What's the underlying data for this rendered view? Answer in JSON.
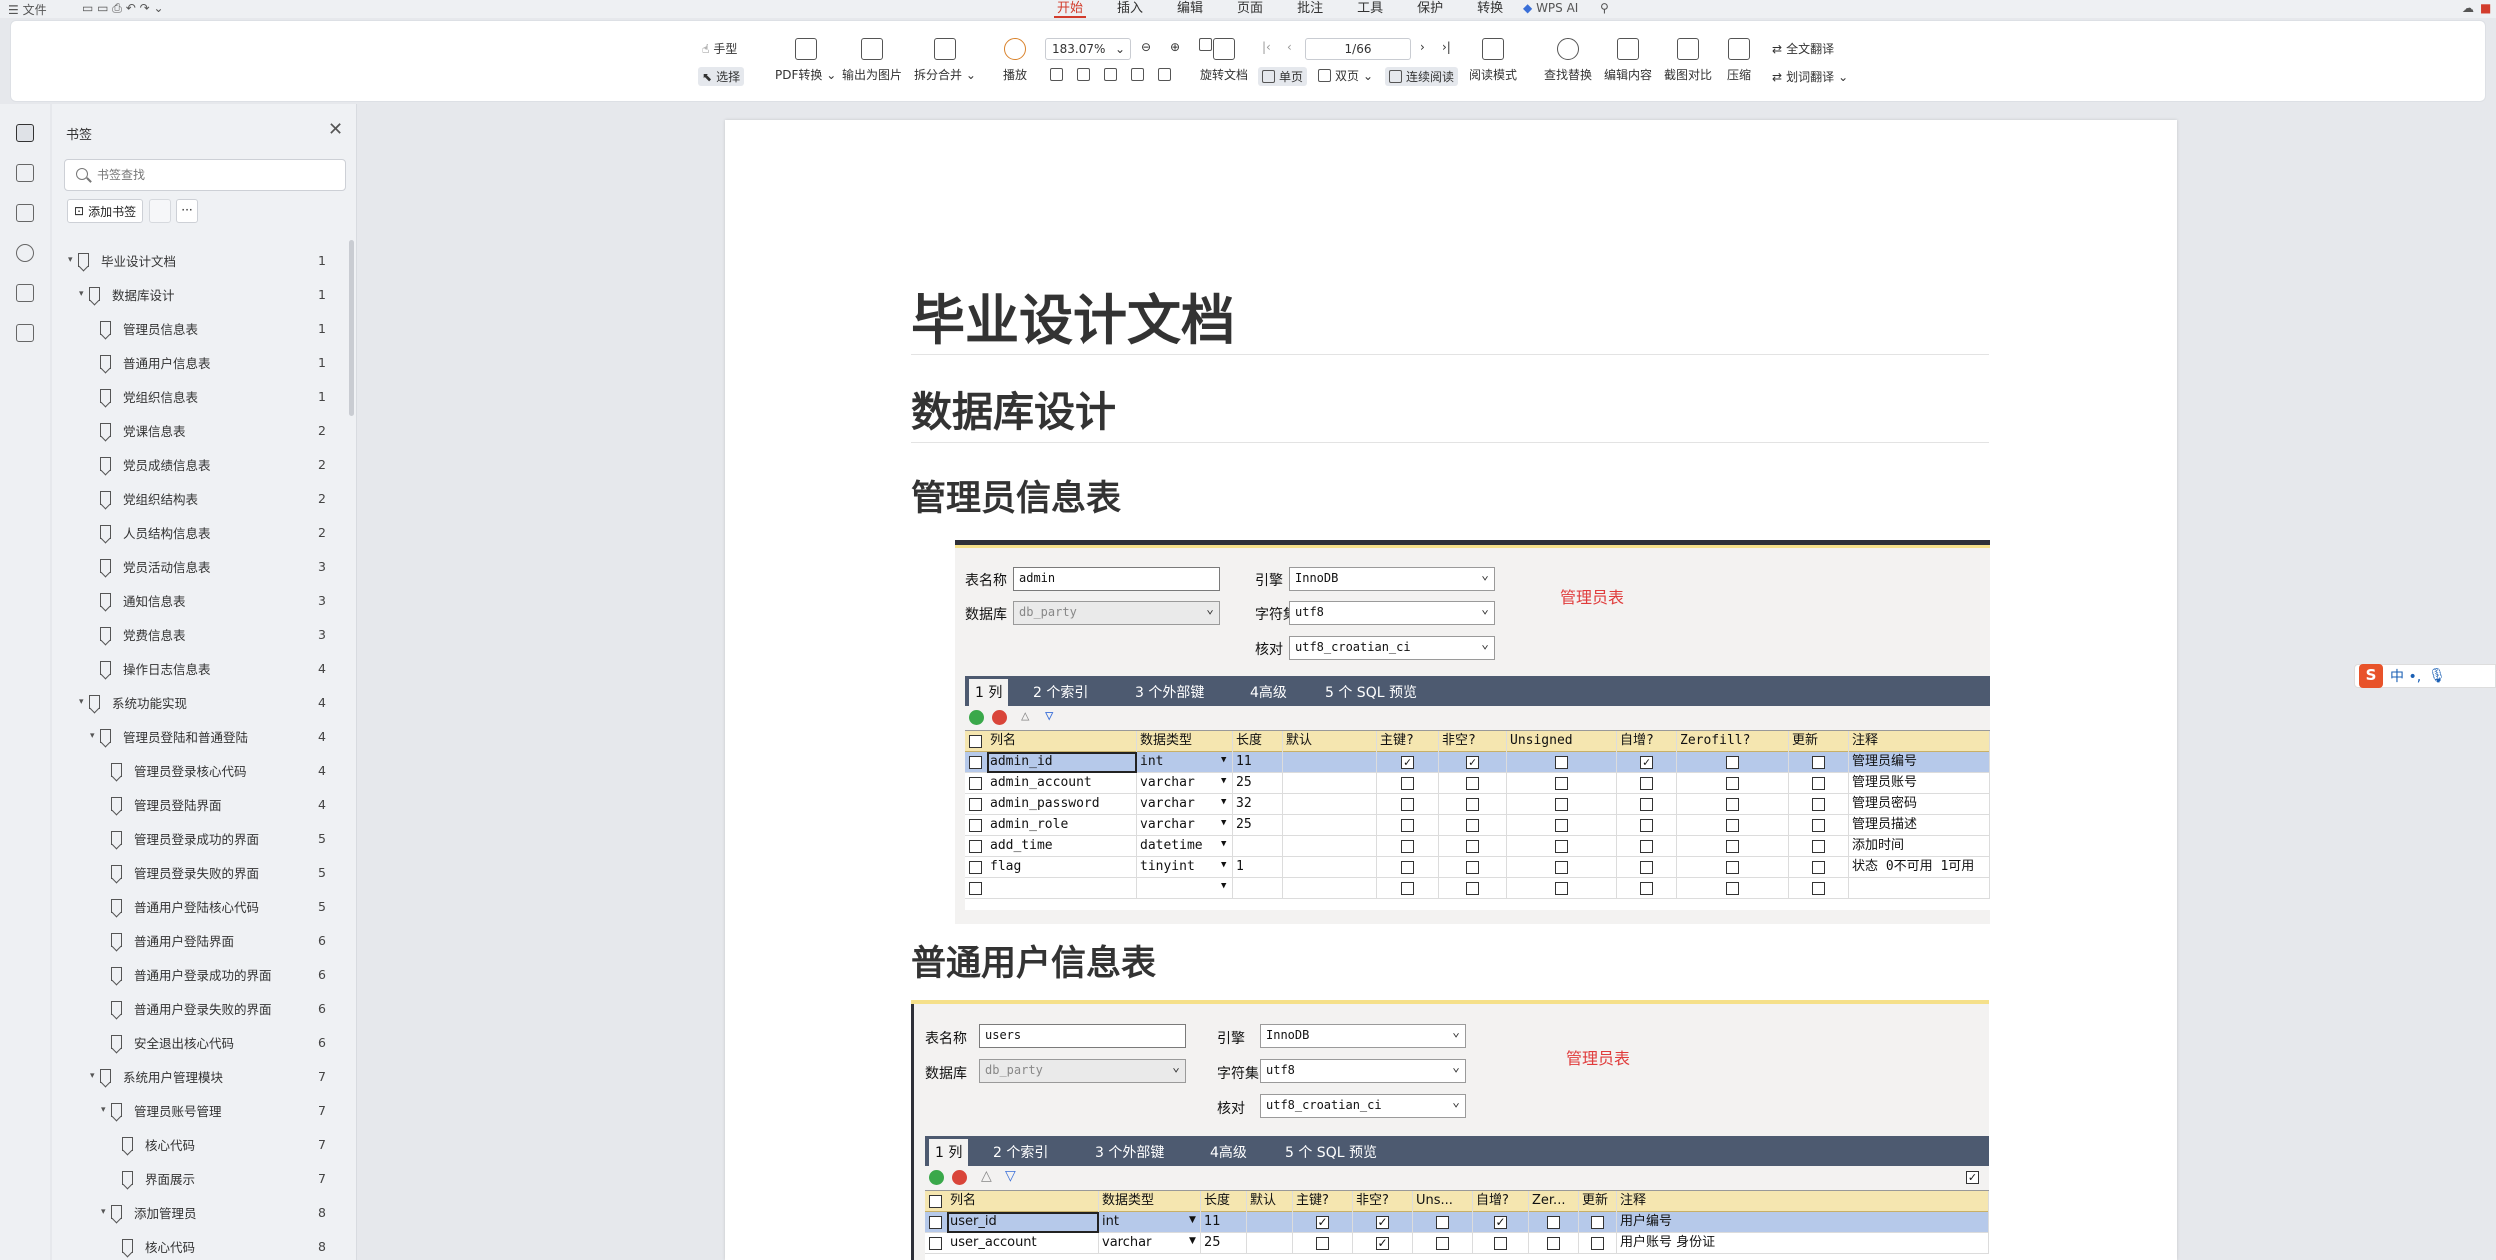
{
  "titlebar": {
    "file_menu": "文件",
    "ai": "WPS AI"
  },
  "menu_tabs": [
    "开始",
    "插入",
    "编辑",
    "页面",
    "批注",
    "工具",
    "保护",
    "转换"
  ],
  "ribbon": {
    "hand": "手型",
    "select": "选择",
    "pdf_convert": "PDF转换",
    "export_image": "输出为图片",
    "split_merge": "拆分合并",
    "play": "播放",
    "zoom": "183.07%",
    "page": "1/66",
    "rotate": "旋转文档",
    "single": "单页",
    "double": "双页",
    "continuous": "连续阅读",
    "read_mode": "阅读模式",
    "find_replace": "查找替换",
    "edit_content": "编辑内容",
    "compare": "截图对比",
    "compress": "压缩",
    "translate_all": "全文翻译",
    "translate_word": "划词翻译"
  },
  "sidebar": {
    "title": "书签",
    "search_placeholder": "书签查找",
    "add_bookmark": "添加书签",
    "more": "···",
    "items": [
      {
        "label": "毕业设计文档",
        "page": "1",
        "level": 0,
        "expand": true
      },
      {
        "label": "数据库设计",
        "page": "1",
        "level": 1,
        "expand": true
      },
      {
        "label": "管理员信息表",
        "page": "1",
        "level": 2
      },
      {
        "label": "普通用户信息表",
        "page": "1",
        "level": 2
      },
      {
        "label": "党组织信息表",
        "page": "1",
        "level": 2
      },
      {
        "label": "党课信息表",
        "page": "2",
        "level": 2
      },
      {
        "label": "党员成绩信息表",
        "page": "2",
        "level": 2
      },
      {
        "label": "党组织结构表",
        "page": "2",
        "level": 2
      },
      {
        "label": "人员结构信息表",
        "page": "2",
        "level": 2
      },
      {
        "label": "党员活动信息表",
        "page": "3",
        "level": 2
      },
      {
        "label": "通知信息表",
        "page": "3",
        "level": 2
      },
      {
        "label": "党费信息表",
        "page": "3",
        "level": 2
      },
      {
        "label": "操作日志信息表",
        "page": "4",
        "level": 2
      },
      {
        "label": "系统功能实现",
        "page": "4",
        "level": 1,
        "expand": true
      },
      {
        "label": "管理员登陆和普通登陆",
        "page": "4",
        "level": 2,
        "expand": true
      },
      {
        "label": "管理员登录核心代码",
        "page": "4",
        "level": 3
      },
      {
        "label": "管理员登陆界面",
        "page": "4",
        "level": 3
      },
      {
        "label": "管理员登录成功的界面",
        "page": "5",
        "level": 3
      },
      {
        "label": "管理员登录失败的界面",
        "page": "5",
        "level": 3
      },
      {
        "label": "普通用户登陆核心代码",
        "page": "5",
        "level": 3
      },
      {
        "label": "普通用户登陆界面",
        "page": "6",
        "level": 3
      },
      {
        "label": "普通用户登录成功的界面",
        "page": "6",
        "level": 3
      },
      {
        "label": "普通用户登录失败的界面",
        "page": "6",
        "level": 3
      },
      {
        "label": "安全退出核心代码",
        "page": "6",
        "level": 3
      },
      {
        "label": "系统用户管理模块",
        "page": "7",
        "level": 2,
        "expand": true
      },
      {
        "label": "管理员账号管理",
        "page": "7",
        "level": 3,
        "expand": true
      },
      {
        "label": "核心代码",
        "page": "7",
        "level": 4
      },
      {
        "label": "界面展示",
        "page": "7",
        "level": 4
      },
      {
        "label": "添加管理员",
        "page": "8",
        "level": 3,
        "expand": true
      },
      {
        "label": "核心代码",
        "page": "8",
        "level": 4
      }
    ]
  },
  "document": {
    "title": "毕业设计文档",
    "h_db": "数据库设计",
    "h_admin": "管理员信息表",
    "h_users": "普通用户信息表",
    "admin_table": {
      "labels": {
        "name": "表名称",
        "db": "数据库",
        "engine": "引擎",
        "charset": "字符集",
        "collate": "核对"
      },
      "name": "admin",
      "db": "db_party",
      "engine": "InnoDB",
      "charset": "utf8",
      "collate": "utf8_croatian_ci",
      "caption": "管理员表",
      "tabs": [
        "1 列",
        "2 个索引",
        "3 个外部键",
        "4高级",
        "5 个 SQL 预览"
      ],
      "headers": [
        "列名",
        "数据类型",
        "长度",
        "默认",
        "主键?",
        "非空?",
        "Unsigned",
        "自增?",
        "Zerofill?",
        "更新",
        "注释"
      ],
      "rows": [
        {
          "name": "admin_id",
          "type": "int",
          "len": "11",
          "pk": true,
          "nn": true,
          "ai": true,
          "comment": "管理员编号"
        },
        {
          "name": "admin_account",
          "type": "varchar",
          "len": "25",
          "pk": false,
          "nn": false,
          "ai": false,
          "comment": "管理员账号"
        },
        {
          "name": "admin_password",
          "type": "varchar",
          "len": "32",
          "pk": false,
          "nn": false,
          "ai": false,
          "comment": "管理员密码"
        },
        {
          "name": "admin_role",
          "type": "varchar",
          "len": "25",
          "pk": false,
          "nn": false,
          "ai": false,
          "comment": "管理员描述"
        },
        {
          "name": "add_time",
          "type": "datetime",
          "len": "",
          "pk": false,
          "nn": false,
          "ai": false,
          "comment": "添加时间"
        },
        {
          "name": "flag",
          "type": "tinyint",
          "len": "1",
          "pk": false,
          "nn": false,
          "ai": false,
          "comment": "状态 0不可用 1可用"
        },
        {
          "name": "",
          "type": "",
          "len": "",
          "pk": false,
          "nn": false,
          "ai": false,
          "comment": ""
        }
      ]
    },
    "users_table": {
      "name": "users",
      "db": "db_party",
      "engine": "InnoDB",
      "charset": "utf8",
      "collate": "utf8_croatian_ci",
      "caption": "管理员表",
      "headers": [
        "列名",
        "数据类型",
        "长度",
        "默认",
        "主键?",
        "非空?",
        "Uns...",
        "自增?",
        "Zer...",
        "更新",
        "注释"
      ],
      "rows": [
        {
          "name": "user_id",
          "type": "int",
          "len": "11",
          "pk": true,
          "nn": true,
          "ai": true,
          "comment": "用户编号"
        },
        {
          "name": "user_account",
          "type": "varchar",
          "len": "25",
          "pk": false,
          "nn": true,
          "ai": false,
          "comment": "用户账号  身份证"
        }
      ]
    }
  },
  "ime": {
    "logo": "S",
    "text": "中 •,"
  }
}
